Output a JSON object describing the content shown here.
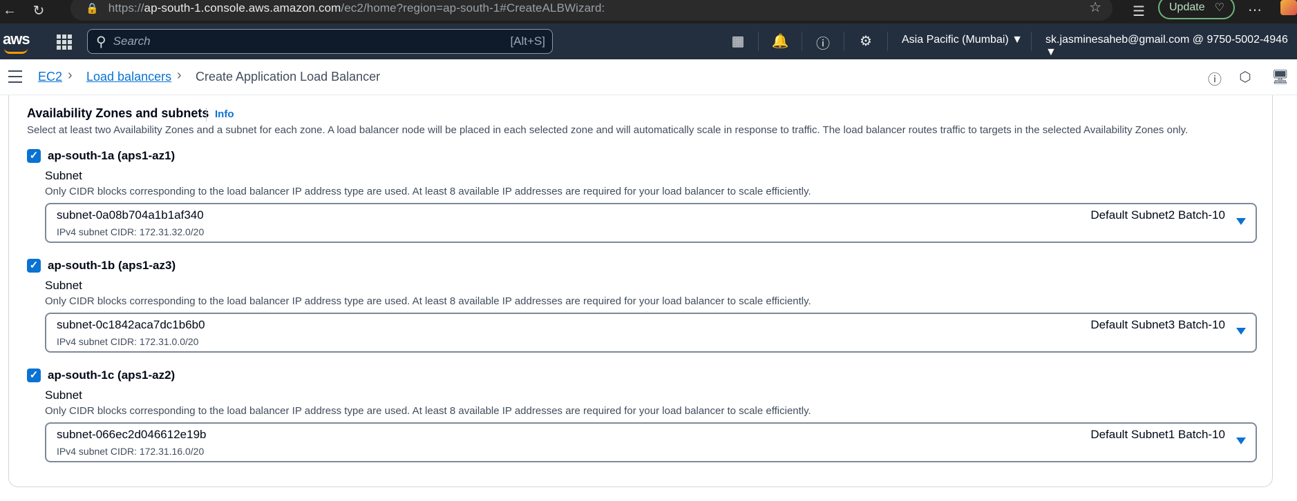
{
  "browser": {
    "url_prefix": "https://",
    "url_host": "ap-south-1.console.aws.amazon.com",
    "url_path": "/ec2/home?region=ap-south-1#CreateALBWizard:",
    "update_label": "Update"
  },
  "aws_nav": {
    "logo_text": "aws",
    "search_placeholder": "Search",
    "search_shortcut": "[Alt+S]",
    "region_label": "Asia Pacific (Mumbai)",
    "account_label": "sk.jasminesaheb@gmail.com @ 9750-5002-4946"
  },
  "breadcrumb": {
    "items": [
      "EC2",
      "Load balancers"
    ],
    "current": "Create Application Load Balancer"
  },
  "section": {
    "title": "Availability Zones and subnets",
    "info_label": "Info",
    "description": "Select at least two Availability Zones and a subnet for each zone. A load balancer node will be placed in each selected zone and will automatically scale in response to traffic. The load balancer routes traffic to targets in the selected Availability Zones only."
  },
  "zones": [
    {
      "name": "ap-south-1a (aps1-az1)",
      "checked": true,
      "subnet_label": "Subnet",
      "help": "Only CIDR blocks corresponding to the load balancer IP address type are used. At least 8 available IP addresses are required for your load balancer to scale efficiently.",
      "subnet_id": "subnet-0a08b704a1b1af340",
      "cidr": "IPv4 subnet CIDR: 172.31.32.0/20",
      "subnet_name": "Default Subnet2 Batch-10"
    },
    {
      "name": "ap-south-1b (aps1-az3)",
      "checked": true,
      "subnet_label": "Subnet",
      "help": "Only CIDR blocks corresponding to the load balancer IP address type are used. At least 8 available IP addresses are required for your load balancer to scale efficiently.",
      "subnet_id": "subnet-0c1842aca7dc1b6b0",
      "cidr": "IPv4 subnet CIDR: 172.31.0.0/20",
      "subnet_name": "Default Subnet3 Batch-10"
    },
    {
      "name": "ap-south-1c (aps1-az2)",
      "checked": true,
      "subnet_label": "Subnet",
      "help": "Only CIDR blocks corresponding to the load balancer IP address type are used. At least 8 available IP addresses are required for your load balancer to scale efficiently.",
      "subnet_id": "subnet-066ec2d046612e19b",
      "cidr": "IPv4 subnet CIDR: 172.31.16.0/20",
      "subnet_name": "Default Subnet1 Batch-10"
    }
  ],
  "icons": {
    "accent": "#0972d3",
    "nav_bg": "#232f3e",
    "brand_orange": "#ff9900"
  }
}
